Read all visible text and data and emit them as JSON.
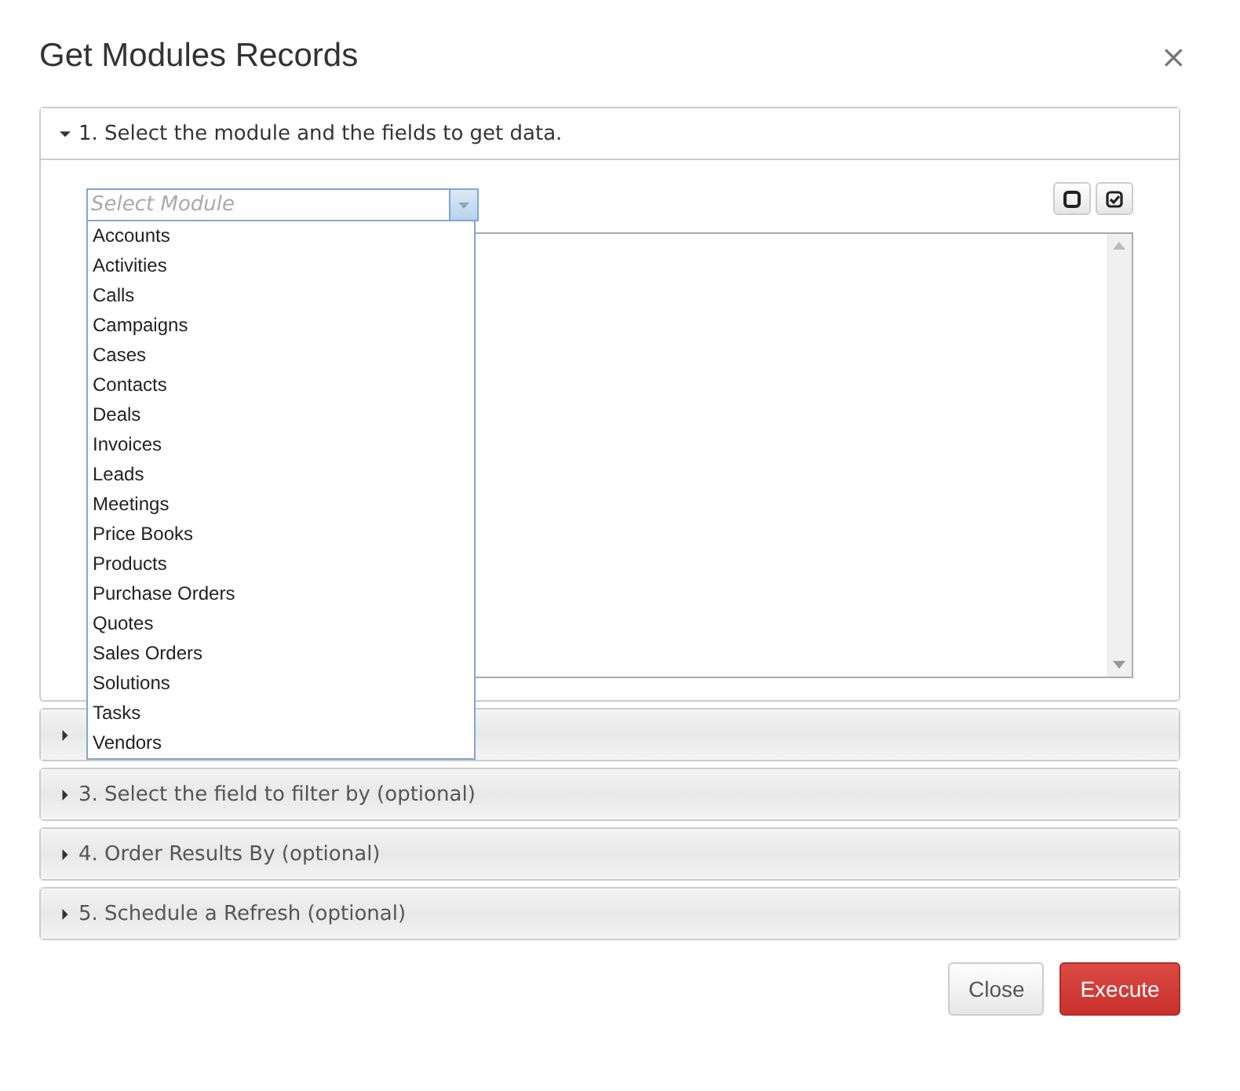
{
  "dialog": {
    "title": "Get Modules Records",
    "close_symbol": "×"
  },
  "sections": [
    {
      "title": "1. Select the module and the fields to get data.",
      "expanded": true
    },
    {
      "expanded": false
    },
    {
      "title": "3. Select the field to filter by (optional)",
      "expanded": false
    },
    {
      "title": "4. Order Results By (optional)",
      "expanded": false
    },
    {
      "title": "5. Schedule a Refresh (optional)",
      "expanded": false
    }
  ],
  "module_select": {
    "placeholder": "Select Module",
    "open": true,
    "options": [
      "Accounts",
      "Activities",
      "Calls",
      "Campaigns",
      "Cases",
      "Contacts",
      "Deals",
      "Invoices",
      "Leads",
      "Meetings",
      "Price Books",
      "Products",
      "Purchase Orders",
      "Quotes",
      "Sales Orders",
      "Solutions",
      "Tasks",
      "Vendors"
    ]
  },
  "field_tools": [
    {
      "kind": "deselect-all"
    },
    {
      "kind": "select-all"
    }
  ],
  "buttons": [
    {
      "label": "Close",
      "kind": "default"
    },
    {
      "label": "Execute",
      "kind": "primary"
    }
  ]
}
